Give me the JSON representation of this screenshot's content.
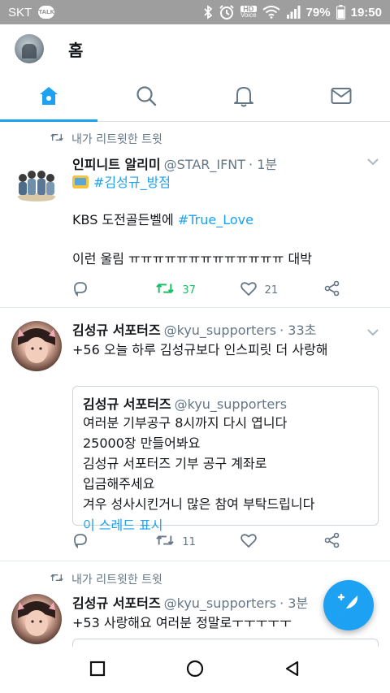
{
  "status_bar": {
    "carrier": "SKT",
    "talk_badge": "TALK",
    "hd_label": "HD",
    "voice_label": "Voice",
    "battery": "79%",
    "time": "19:50"
  },
  "header": {
    "title": "홈"
  },
  "tabs": [
    {
      "icon": "home-icon",
      "active": true
    },
    {
      "icon": "search-icon",
      "active": false
    },
    {
      "icon": "bell-icon",
      "active": false
    },
    {
      "icon": "mail-icon",
      "active": false
    }
  ],
  "colors": {
    "accent": "#1da1f2",
    "retweet_green": "#17bf63",
    "muted": "#657786",
    "status_bar": "#9e9e9e"
  },
  "tweets": [
    {
      "context": "내가 리트윗한 트윗",
      "name": "인피니트 알리미",
      "handle": "@STAR_IFNT",
      "time": "· 1분",
      "line_hashtag": "#김성규_방점",
      "line2_text": "KBS 도전골든벨에 ",
      "line2_tag": "#True_Love",
      "line3": "이런 울림 ㅠㅠㅠㅠㅠㅠㅠㅠㅠㅠㅠㅠㅠ 대박",
      "retweets": "37",
      "likes": "21"
    },
    {
      "name": "김성규 서포터즈",
      "handle": "@kyu_supporters",
      "time": "· 33초",
      "text": "+56 오늘 하루 김성규보다 인스피릿 더 사랑해",
      "quote": {
        "name": "김성규 서포터즈",
        "handle": "@kyu_supporters",
        "lines": [
          "여러분 기부공구 8시까지 다시 엽니다",
          "25000장 만들어봐요",
          "김성규 서포터즈 기부 공구 계좌로",
          "입금해주세요",
          "겨우 성사시킨거니 많은 참여 부탁드립니다"
        ],
        "more": "이 스레드 표시"
      },
      "retweets": "11"
    },
    {
      "context": "내가 리트윗한 트윗",
      "name": "김성규 서포터즈",
      "handle": "@kyu_supporters",
      "time": "· 3분",
      "text": "+53 사랑해요 여러분 정말로ㅜㅜㅜㅜㅜ"
    }
  ]
}
